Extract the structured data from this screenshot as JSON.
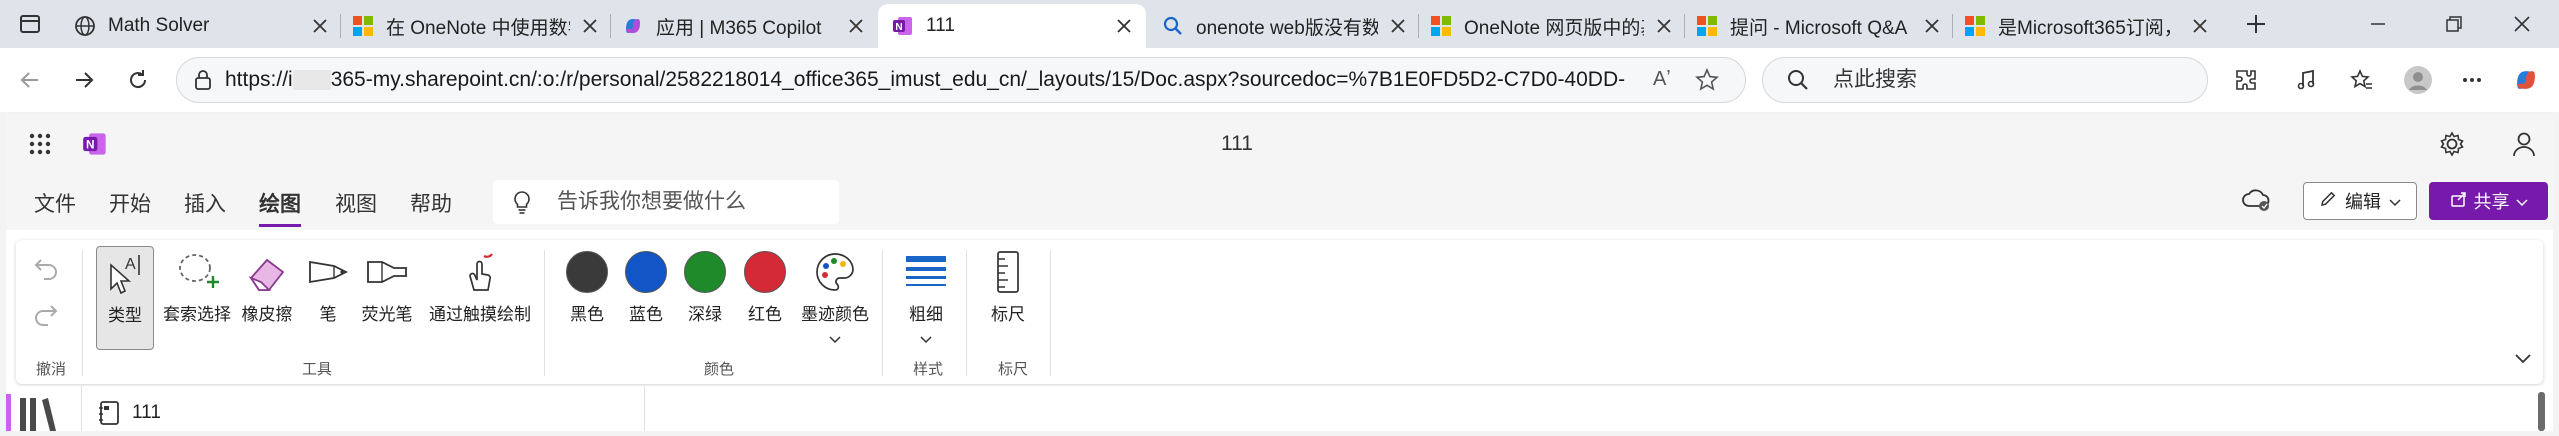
{
  "tabs": [
    {
      "title": "Math Solver",
      "icon": "globe-icon"
    },
    {
      "title": "在 OneNote 中使用数学",
      "icon": "microsoft-logo-icon"
    },
    {
      "title": "应用 | M365 Copilot",
      "icon": "copilot-icon"
    },
    {
      "title": "111",
      "icon": "onenote-icon"
    },
    {
      "title": "onenote web版没有数学",
      "icon": "search-icon"
    },
    {
      "title": "OneNote 网页版中的基本",
      "icon": "microsoft-logo-icon"
    },
    {
      "title": "提问 - Microsoft Q&A",
      "icon": "microsoft-logo-icon"
    },
    {
      "title": "是Microsoft365订阅，",
      "icon": "microsoft-logo-icon"
    }
  ],
  "address": {
    "url_prefix": "https://i",
    "url_rest": "365-my.sharepoint.cn/:o:/r/personal/2582218014_office365_imust_edu_cn/_layouts/15/Doc.aspx?sourcedoc=%7B1E0FD5D2-C7D0-40DD-9...",
    "search_placeholder": "点此搜索"
  },
  "app": {
    "title": "111",
    "menu": [
      "文件",
      "开始",
      "插入",
      "绘图",
      "视图",
      "帮助"
    ],
    "selected_menu": "绘图",
    "tellme_placeholder": "告诉我你想要做什么",
    "edit_label": "编辑",
    "share_label": "共享"
  },
  "ribbon": {
    "undo_group": "撤消",
    "tools": {
      "type": "类型",
      "lasso": "套索选择",
      "eraser": "橡皮擦",
      "pen": "笔",
      "highlighter": "荧光笔",
      "touch": "通过触摸绘制",
      "group": "工具"
    },
    "colors": {
      "black": "黑色",
      "blue": "蓝色",
      "darkgreen": "深绿",
      "red": "红色",
      "inkcolor": "墨迹颜色",
      "group": "颜色"
    },
    "style": {
      "thickness": "粗细",
      "group": "样式"
    },
    "ruler": {
      "ruler": "标尺",
      "group": "标尺"
    }
  },
  "notebook": {
    "page_name": "111"
  },
  "swatch_colors": {
    "black": "#3a3a3a",
    "blue": "#1155c6",
    "darkgreen": "#1e8a2a",
    "red": "#d42a35"
  },
  "accent": "#7719aa"
}
